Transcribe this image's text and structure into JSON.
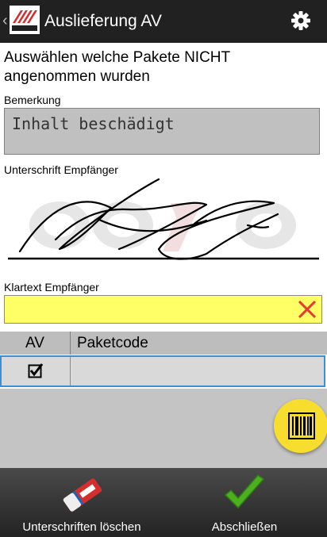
{
  "appbar": {
    "title": "Auslieferung AV",
    "back_glyph": "‹",
    "logo_icon": "company-logo-icon",
    "settings_icon": "gear-icon"
  },
  "heading": "Auswählen welche Pakete NICHT angenommen wurden",
  "remark": {
    "label": "Bemerkung",
    "value": "Inhalt beschädigt"
  },
  "signature": {
    "label": "Unterschrift Empfänger"
  },
  "recipient_name": {
    "label": "Klartext Empfänger",
    "value": "",
    "clear_icon": "close-icon"
  },
  "table": {
    "columns": [
      "AV",
      "Paketcode"
    ],
    "rows": [
      {
        "av_checked": true,
        "paketcode": ""
      }
    ]
  },
  "scan_button": {
    "icon": "barcode-icon"
  },
  "actions": {
    "clear_signature_label": "Unterschriften löschen",
    "finish_label": "Abschließen"
  },
  "colors": {
    "appbar": "#212121",
    "name_field": "#ffff66",
    "fab": "#f7dd2e",
    "row_highlight": "#3b8fd6",
    "clear_x": "#e53935",
    "check_green": "#4caf1f"
  }
}
